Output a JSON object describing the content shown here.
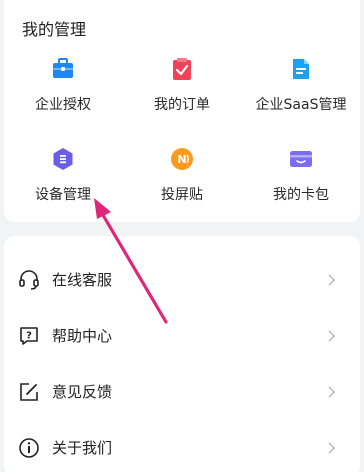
{
  "management": {
    "title": "我的管理",
    "items": [
      {
        "label": "企业授权",
        "icon": "briefcase-icon"
      },
      {
        "label": "我的订单",
        "icon": "order-clipboard-icon"
      },
      {
        "label": "企业SaaS管理",
        "icon": "saas-document-icon"
      },
      {
        "label": "设备管理",
        "icon": "device-hexagon-icon"
      },
      {
        "label": "投屏贴",
        "icon": "cast-sticker-icon"
      },
      {
        "label": "我的卡包",
        "icon": "card-wallet-icon"
      }
    ]
  },
  "menu": [
    {
      "label": "在线客服",
      "icon": "headset-icon"
    },
    {
      "label": "帮助中心",
      "icon": "help-question-icon"
    },
    {
      "label": "意见反馈",
      "icon": "edit-feedback-icon"
    },
    {
      "label": "关于我们",
      "icon": "info-icon"
    }
  ],
  "colors": {
    "accent_blue": "#1e88f0",
    "accent_red": "#f0435a",
    "accent_purple": "#6a5ee8",
    "accent_orange": "#ff9a1f",
    "annotation_arrow": "#e0267a"
  }
}
